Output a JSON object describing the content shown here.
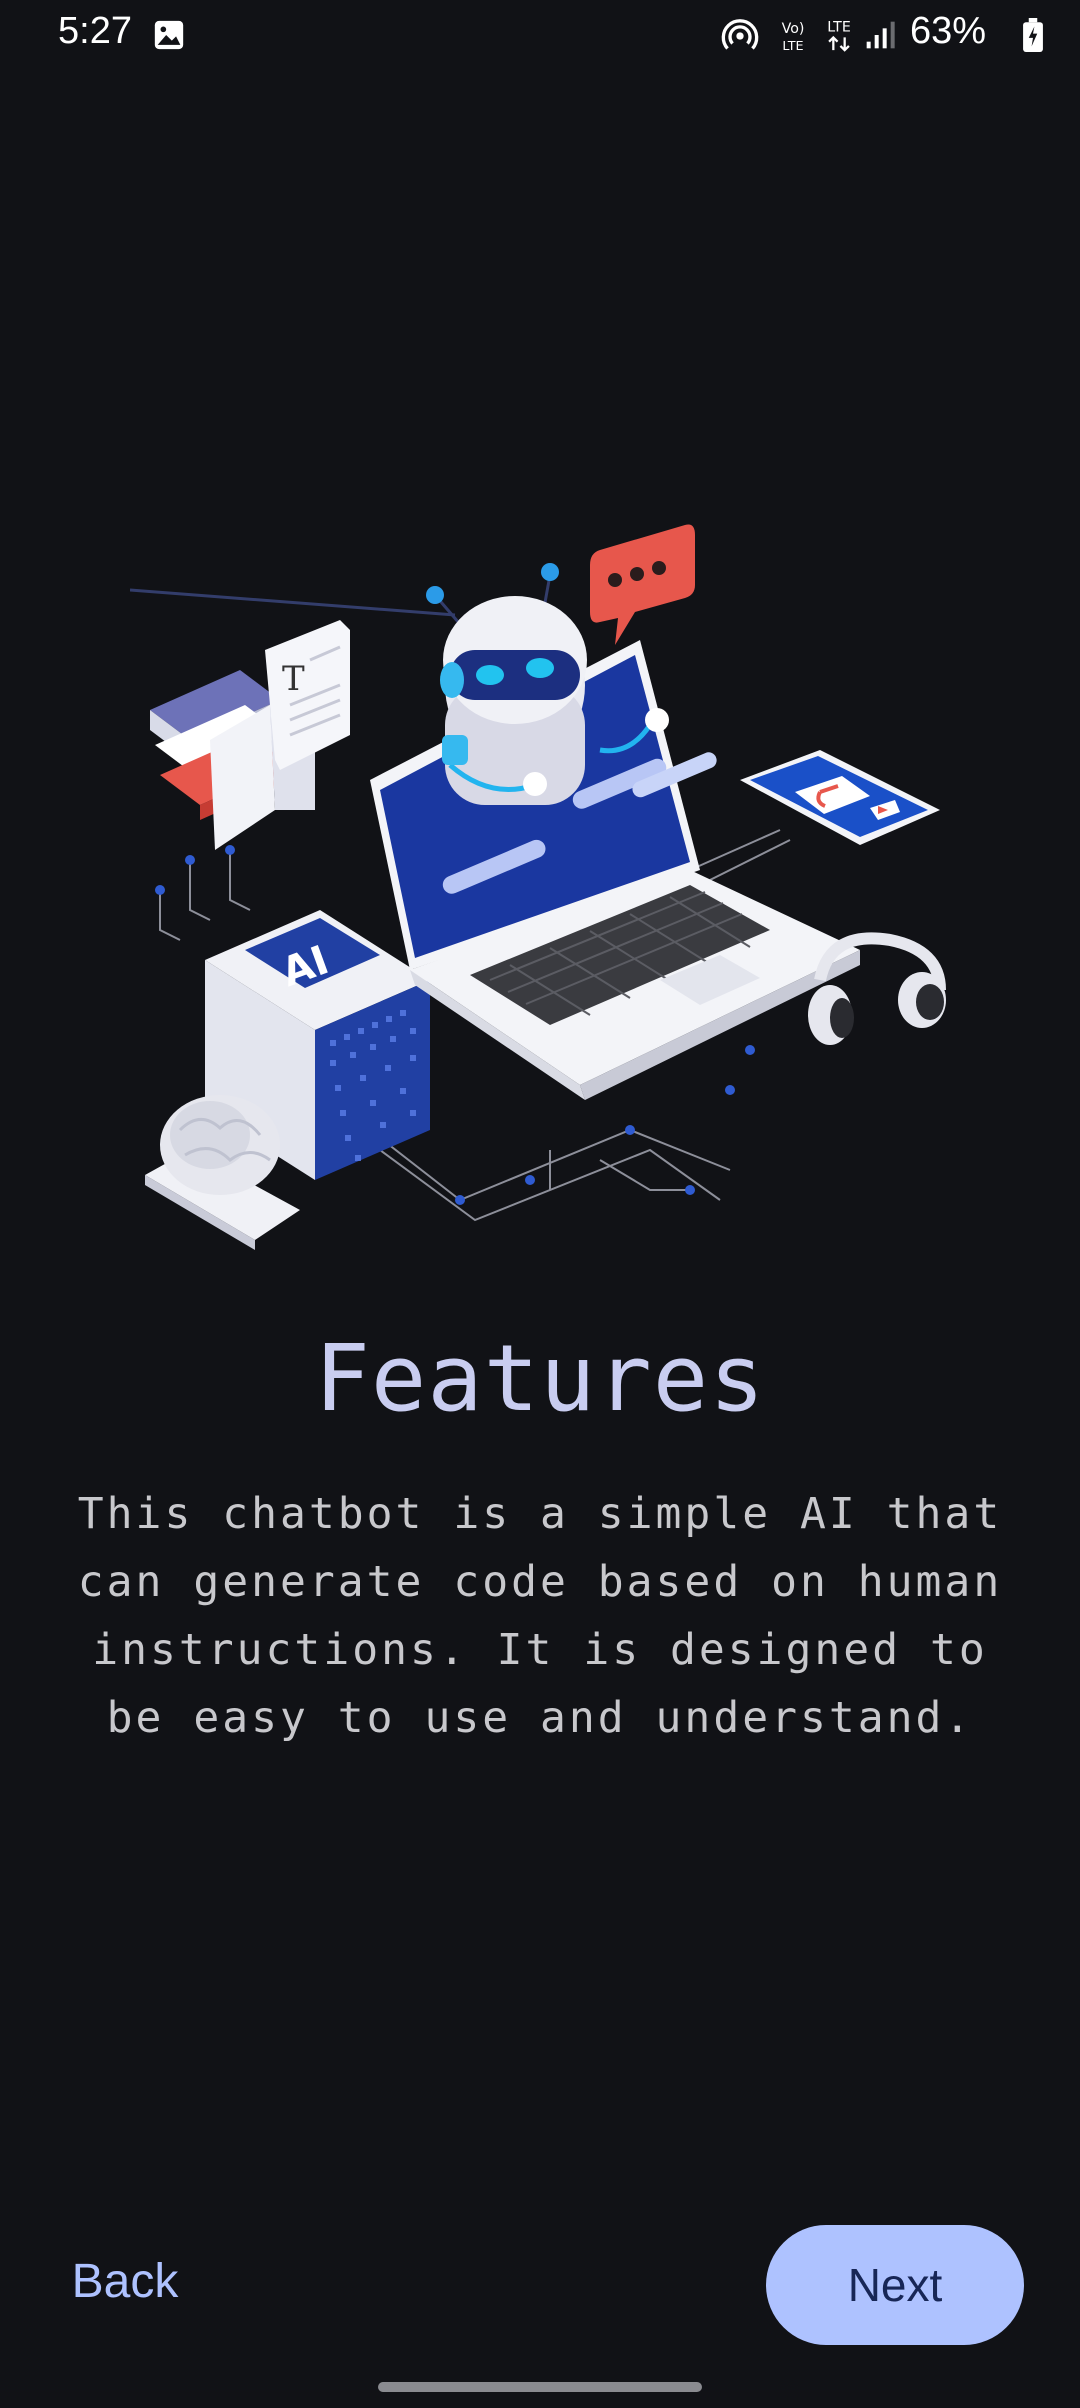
{
  "status_bar": {
    "time": "5:27",
    "battery_percent": "63%",
    "icons": [
      "gallery-icon",
      "hotspot-icon",
      "volte-icon",
      "lte-icon",
      "signal-icon",
      "battery-charging-icon"
    ]
  },
  "illustration": {
    "badge_text": "AI",
    "book_letter": "T",
    "icons": [
      "robot-icon",
      "laptop-icon",
      "chat-bubble-icon",
      "books-icon",
      "ai-chip-icon",
      "brain-icon",
      "phone-icon",
      "headphones-icon"
    ]
  },
  "onboarding": {
    "title": "Features",
    "description": "This chatbot is a simple AI that can generate code based on human instructions. It is designed to be easy to use and understand."
  },
  "navigation": {
    "back_label": "Back",
    "next_label": "Next"
  },
  "colors": {
    "background": "#111216",
    "title": "#c9cdf0",
    "accent": "#aec2ff",
    "accent_text": "#172656",
    "body_text": "#c8c8cc"
  }
}
